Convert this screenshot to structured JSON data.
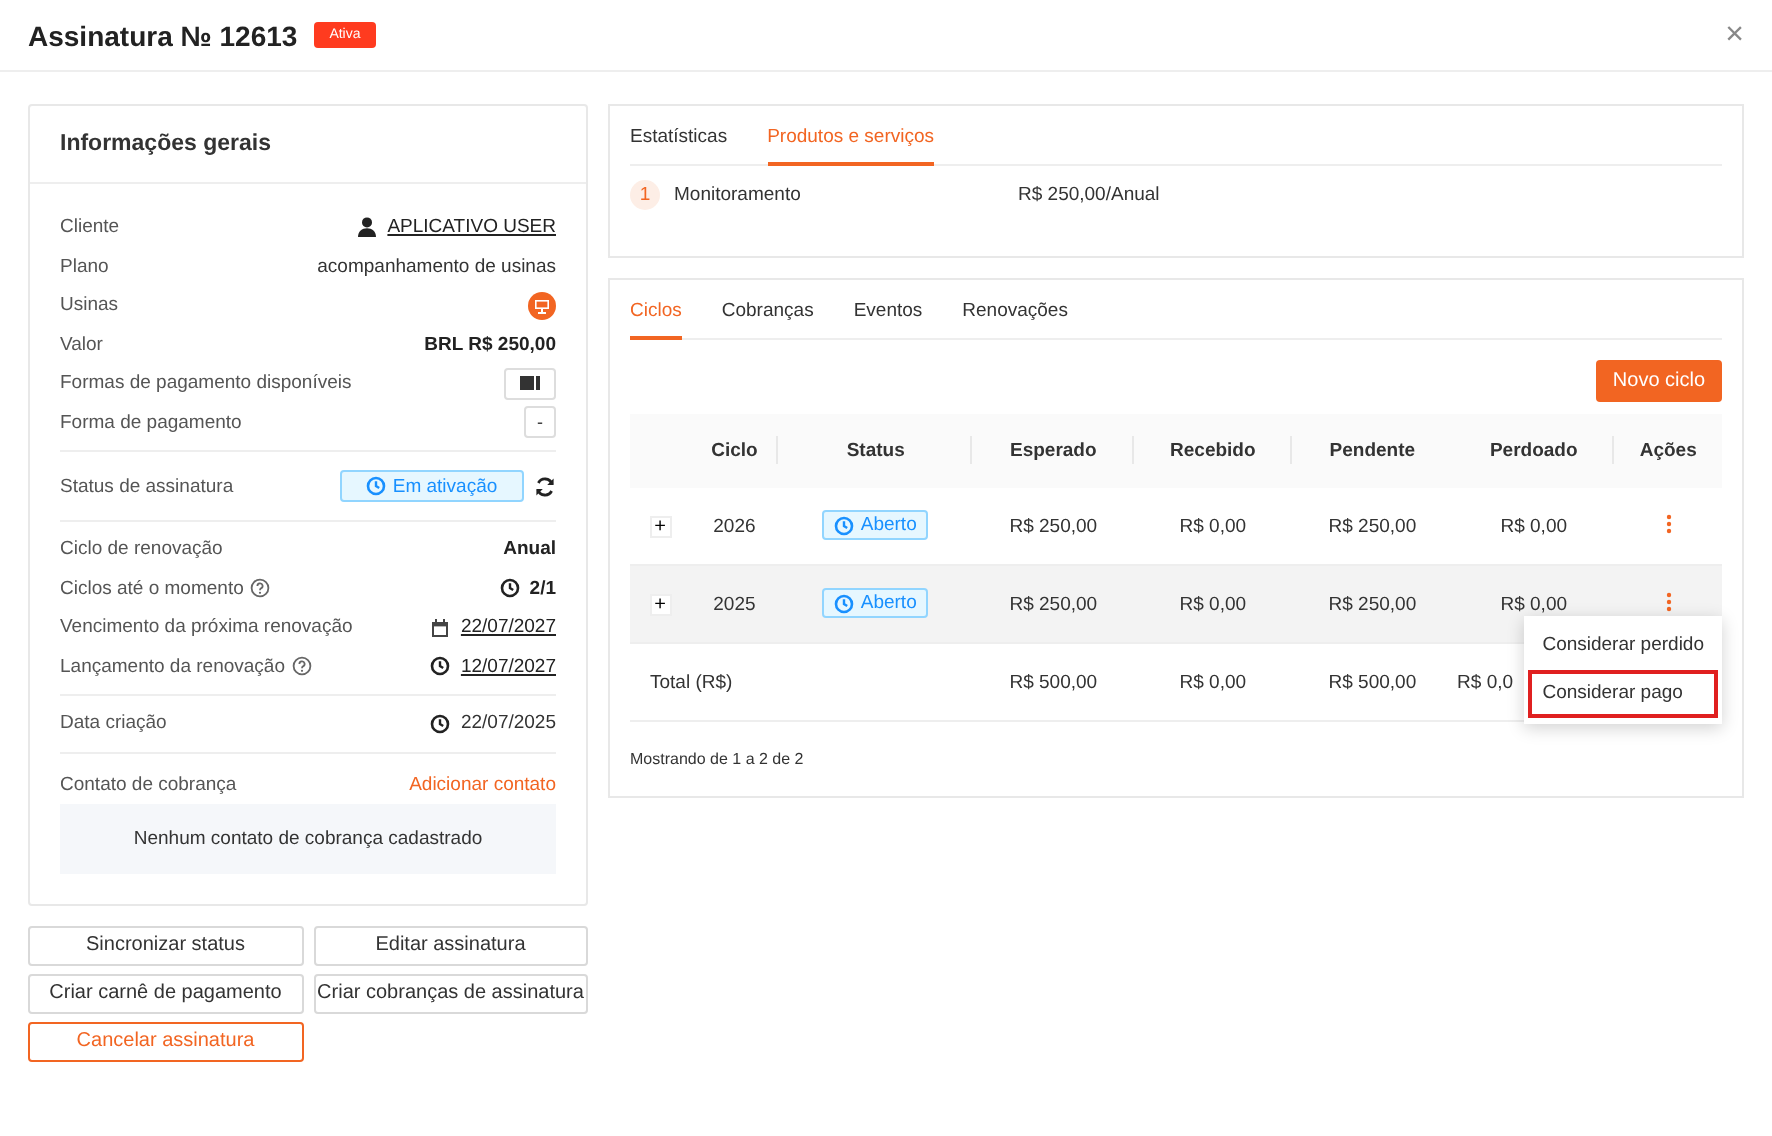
{
  "header": {
    "title": "Assinatura № 12613",
    "badge": "Ativa",
    "close": "×"
  },
  "info": {
    "title": "Informações gerais",
    "sections": [
      [
        {
          "label": "Cliente",
          "kind": "user-link",
          "value": "APLICATIVO USER"
        },
        {
          "label": "Plano",
          "kind": "text",
          "value": "acompanhamento de usinas"
        },
        {
          "label": "Usinas",
          "kind": "plant"
        },
        {
          "label": "Valor",
          "kind": "bold",
          "value": "BRL R$ 250,00"
        },
        {
          "label": "Formas de pagamento disponíveis",
          "kind": "card"
        },
        {
          "label": "Forma de pagamento",
          "kind": "dash",
          "value": "-"
        }
      ],
      [
        {
          "label": "Status de assinatura",
          "kind": "status",
          "value": "Em ativação"
        }
      ],
      [
        {
          "label": "Ciclo de renovação",
          "kind": "bold",
          "value": "Anual"
        },
        {
          "label": "Ciclos até o momento",
          "help": true,
          "kind": "clock-bold",
          "value": "2/1"
        },
        {
          "label": "Vencimento da próxima renovação",
          "help": false,
          "kind": "calendar-link",
          "value": "22/07/2027"
        },
        {
          "label": "Lançamento da renovação",
          "help": true,
          "kind": "clock-link",
          "value": "12/07/2027"
        }
      ],
      [
        {
          "label": "Data criação",
          "kind": "clock",
          "value": "22/07/2025"
        }
      ]
    ],
    "contact": {
      "label": "Contato de cobrança",
      "link": "Adicionar contato",
      "empty": "Nenhum contato de cobrança cadastrado"
    }
  },
  "buttons": [
    {
      "label": "Sincronizar status",
      "kind": "default"
    },
    {
      "label": "Editar assinatura",
      "kind": "default"
    },
    {
      "label": "Criar carnê de pagamento",
      "kind": "default"
    },
    {
      "label": "Criar cobranças de assinatura",
      "kind": "default"
    },
    {
      "label": "Cancelar assinatura",
      "kind": "danger"
    }
  ],
  "products": {
    "tabs": [
      {
        "label": "Estatísticas",
        "selected": false
      },
      {
        "label": "Produtos e serviços",
        "selected": true
      }
    ],
    "items": [
      {
        "number": "1",
        "name": "Monitoramento",
        "price": "R$ 250,00/Anual"
      }
    ]
  },
  "cycles": {
    "tabs": [
      {
        "label": "Ciclos",
        "selected": true
      },
      {
        "label": "Cobranças",
        "selected": false
      },
      {
        "label": "Eventos",
        "selected": false
      },
      {
        "label": "Renovações",
        "selected": false
      }
    ],
    "new_button": "Novo ciclo",
    "columns": [
      "Ciclo",
      "Status",
      "Esperado",
      "Recebido",
      "Pendente",
      "Perdoado",
      "Ações"
    ],
    "rows": [
      {
        "expand": "+",
        "cycle": "2026",
        "status": "Aberto",
        "expected": "R$ 250,00",
        "received": "R$ 0,00",
        "pending": "R$ 250,00",
        "forgiven": "R$ 0,00",
        "highlighted": false
      },
      {
        "expand": "+",
        "cycle": "2025",
        "status": "Aberto",
        "expected": "R$ 250,00",
        "received": "R$ 0,00",
        "pending": "R$ 250,00",
        "forgiven": "R$ 0,00",
        "highlighted": true
      }
    ],
    "total": {
      "label": "Total (R$)",
      "expected": "R$ 500,00",
      "received": "R$ 0,00",
      "pending": "R$ 500,00",
      "forgiven": "R$ 0,0"
    },
    "menu": [
      {
        "label": "Considerar perdido",
        "selected": false
      },
      {
        "label": "Considerar pago",
        "selected": true
      }
    ],
    "footer": "Mostrando de 1 a 2 de 2"
  }
}
